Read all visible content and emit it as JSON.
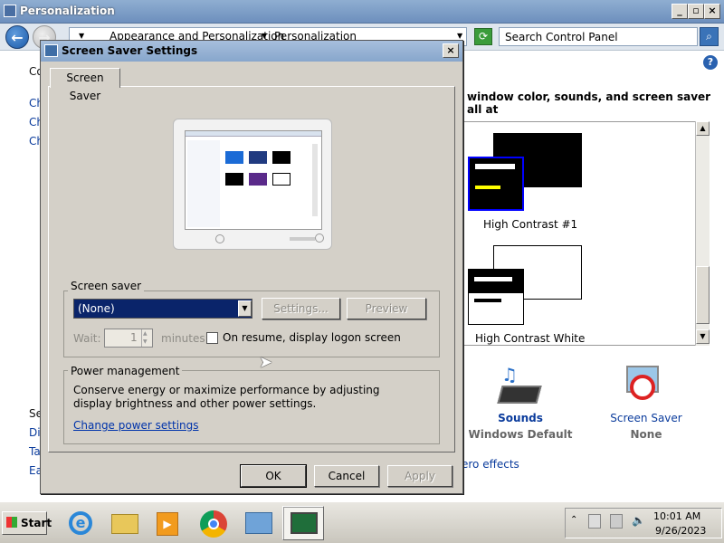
{
  "main_window": {
    "title": "Personalization",
    "breadcrumbs": [
      "Appearance and Personalization",
      "Personalization"
    ],
    "search_placeholder": "Search Control Panel",
    "left_partial": [
      "Co",
      "Ch",
      "Ch",
      "Ch",
      "Se",
      "Di",
      "Ta",
      "Ea"
    ],
    "headline": "window color, sounds, and screen saver all at",
    "themes": [
      {
        "name": "High Contrast #1"
      },
      {
        "name": "High Contrast White"
      }
    ],
    "sounds": {
      "title": "Sounds",
      "value": "Windows Default"
    },
    "screen_saver": {
      "title": "Screen Saver",
      "value": "None"
    },
    "partial_link": "ero effects"
  },
  "dialog": {
    "title": "Screen Saver Settings",
    "tab_label": "Screen Saver",
    "screen_saver_group": "Screen saver",
    "selected_saver": "(None)",
    "settings_button": "Settings...",
    "preview_button": "Preview",
    "wait_label": "Wait:",
    "wait_value": "1",
    "minutes_label": "minutes",
    "resume_label": "On resume, display logon screen",
    "power_group": "Power management",
    "power_description": "Conserve energy or maximize performance by adjusting display brightness and other power settings.",
    "power_link": "Change power settings",
    "ok_button": "OK",
    "cancel_button": "Cancel",
    "apply_button": "Apply"
  },
  "taskbar": {
    "start_label": "Start",
    "time": "10:01 AM",
    "date": "9/26/2023",
    "apps": [
      "internet-explorer",
      "windows-explorer",
      "media-player",
      "chrome",
      "control-panel",
      "personalization"
    ]
  },
  "colors": {
    "title_bar": "#87a6cc",
    "dialog_face": "#d4d0c8",
    "selection": "#0a246a",
    "link": "#0033aa"
  }
}
